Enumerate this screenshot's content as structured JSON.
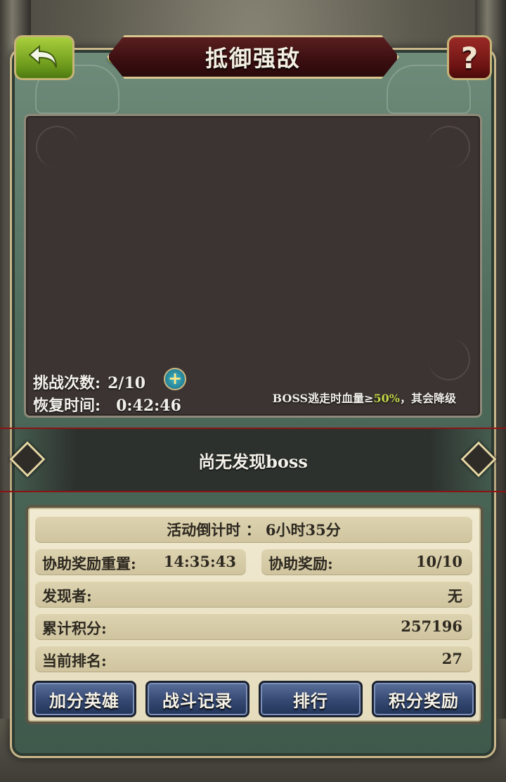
{
  "header": {
    "title": "抵御强敌",
    "help_glyph": "?"
  },
  "challenge": {
    "attempts_label": "挑战次数:",
    "attempts_value": "2/10",
    "recovery_label": "恢复时间:",
    "recovery_value": "0:42:46",
    "note_prefix": "BOSS逃走时血量≥",
    "note_percent": "50%",
    "note_suffix": "，其会降级"
  },
  "boss_status": "尚无发现boss",
  "info": {
    "countdown": "活动倒计时 ： 6小时35分",
    "assist_reset_label": "协助奖励重置:",
    "assist_reset_value": "14:35:43",
    "assist_reward_label": "协助奖励:",
    "assist_reward_value": "10/10",
    "finder_label": "发现者:",
    "finder_value": "无",
    "score_label": "累计积分:",
    "score_value": "257196",
    "rank_label": "当前排名:",
    "rank_value": "27"
  },
  "buttons": {
    "bonus_heroes": "加分英雄",
    "battle_log": "战斗记录",
    "ranking": "排行",
    "score_rewards": "积分奖励"
  },
  "colors": {
    "accent_green": "#b7d14a",
    "banner_red": "#8a1414",
    "button_blue": "#344872"
  },
  "icons": [
    "back-arrow-icon",
    "help-icon",
    "plus-icon",
    "left-arrow-icon",
    "right-arrow-icon"
  ]
}
